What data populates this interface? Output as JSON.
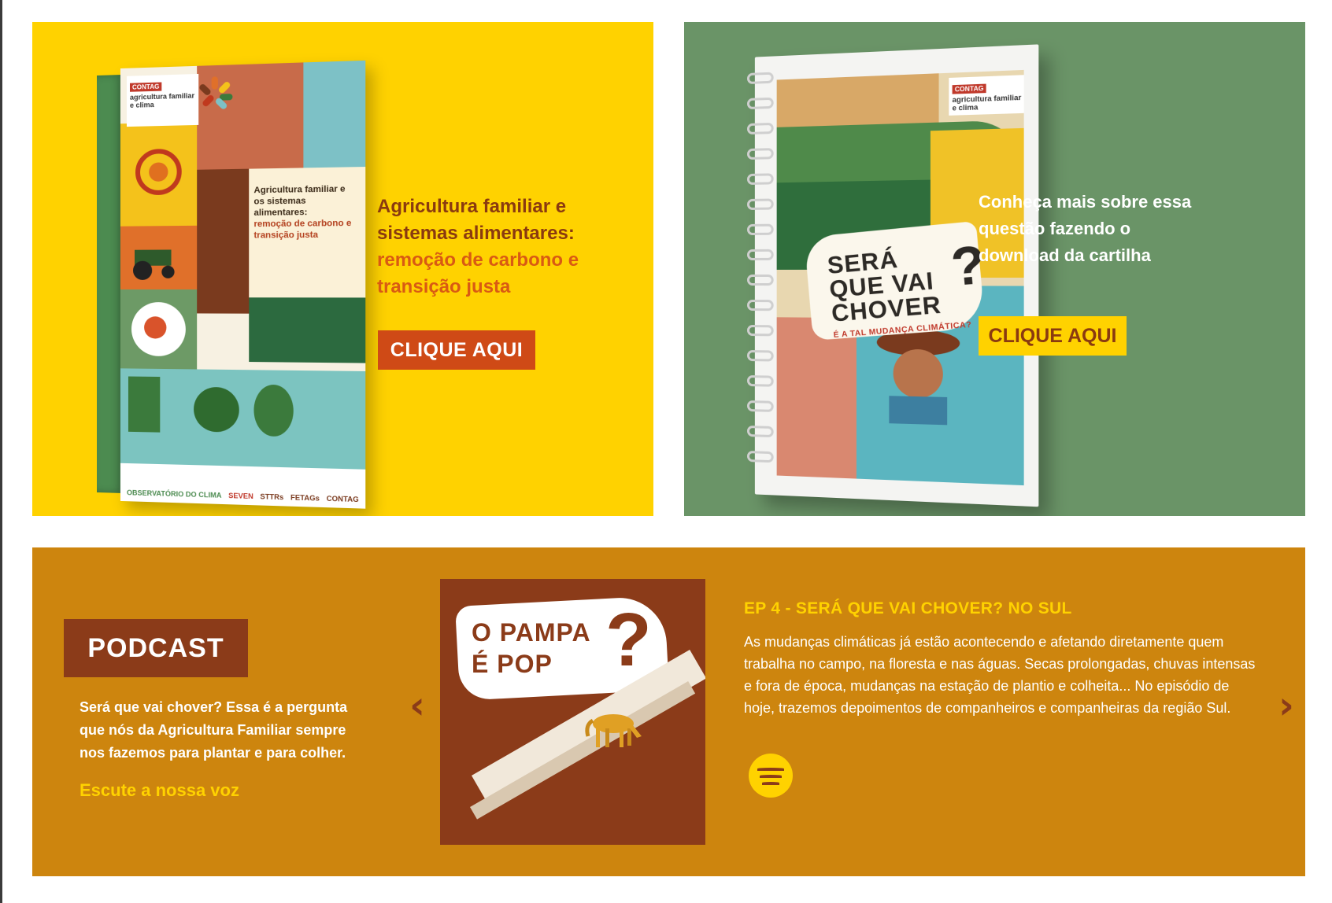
{
  "cards": {
    "left": {
      "book": {
        "logo_tag": "CONTAG",
        "logo_text": "agricultura familiar e clima",
        "title_main": "Agricultura familiar e os sistemas alimentares:",
        "title_highlight": "remoção de carbono e transição justa",
        "footer": [
          "OBSERVATÓRIO DO CLIMA",
          "SEVEN",
          "STTRs",
          "FETAGs",
          "CONTAG"
        ]
      },
      "heading": "Agricultura familiar e sistemas alimentares:",
      "subheading": "remoção de carbono e transição justa",
      "button_label": "CLIQUE AQUI",
      "bg_color": "#FFD200",
      "button_color": "#CF4A16"
    },
    "right": {
      "notebook": {
        "logo_tag": "CONTAG",
        "logo_text": "agricultura familiar e clima",
        "title": "SERÁ QUE VAI CHOVER",
        "question_mark": "?",
        "subtitle": "É A TAL MUDANÇA CLIMÁTICA?"
      },
      "description": "Conheça mais sobre essa questão fazendo o download da cartilha",
      "button_label": "CLIQUE AQUI",
      "bg_color": "#6A9467",
      "button_color": "#FFD200"
    }
  },
  "podcast": {
    "badge": "PODCAST",
    "intro": "Será que vai chover? Essa é a pergunta que nós da Agricultura Familiar sempre nos fazemos para plantar e para colher.",
    "listen_link": "Escute a nossa voz",
    "cover": {
      "title_line1": "O PAMPA",
      "title_line2": "É POP",
      "question_mark": "?"
    },
    "episode_title": "EP 4 - SERÁ QUE VAI CHOVER? NO SUL",
    "episode_description": "As mudanças climáticas já estão acontecendo e afetando diretamente quem trabalha no campo, na floresta e nas águas. Secas prolongadas, chuvas intensas e fora de época, mudanças na estação de plantio e colheita... No episódio de hoje, trazemos depoimentos de companheiros e companheiras da região Sul.",
    "prev_arrow": "‹",
    "next_arrow": "›",
    "icons": {
      "spotify": "spotify-icon",
      "prev": "chevron-left-icon",
      "next": "chevron-right-icon"
    },
    "bg_color": "#CD850E",
    "badge_color": "#8B3B19"
  }
}
